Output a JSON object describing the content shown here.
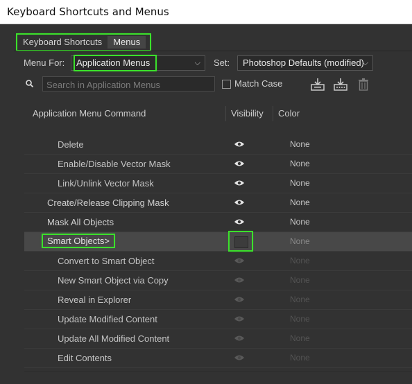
{
  "window": {
    "title": "Keyboard Shortcuts and Menus"
  },
  "tabs": [
    {
      "label": "Keyboard Shortcuts",
      "active": false
    },
    {
      "label": "Menus",
      "active": true
    }
  ],
  "menu_for": {
    "label": "Menu For:",
    "value": "Application Menus"
  },
  "set": {
    "label": "Set:",
    "value": "Photoshop Defaults (modified)"
  },
  "search": {
    "placeholder": "Search in Application Menus",
    "value": ""
  },
  "match_case": {
    "label": "Match Case",
    "checked": false
  },
  "toolbar": {
    "icons": [
      "save-set-icon",
      "save-set-as-icon",
      "delete-set-icon"
    ]
  },
  "columns": {
    "command": "Application Menu Command",
    "visibility": "Visibility",
    "color": "Color"
  },
  "rows": [
    {
      "label": "Delete",
      "indent": 2,
      "visible": true,
      "color": "None"
    },
    {
      "label": "Enable/Disable Vector Mask",
      "indent": 2,
      "visible": true,
      "color": "None"
    },
    {
      "label": "Link/Unlink Vector Mask",
      "indent": 2,
      "visible": true,
      "color": "None"
    },
    {
      "label": "Create/Release Clipping Mask",
      "indent": 1,
      "visible": true,
      "color": "None"
    },
    {
      "label": "Mask All Objects",
      "indent": 1,
      "visible": true,
      "color": "None"
    },
    {
      "label": "Smart Objects>",
      "indent": 1,
      "visible": false,
      "color": "None",
      "selected": true
    },
    {
      "label": "Convert to Smart Object",
      "indent": 2,
      "visible": true,
      "color": "None",
      "dim": true
    },
    {
      "label": "New Smart Object via Copy",
      "indent": 2,
      "visible": true,
      "color": "None",
      "dim": true
    },
    {
      "label": "Reveal in Explorer",
      "indent": 2,
      "visible": true,
      "color": "None",
      "dim": true
    },
    {
      "label": "Update Modified Content",
      "indent": 2,
      "visible": true,
      "color": "None",
      "dim": true
    },
    {
      "label": "Update All Modified Content",
      "indent": 2,
      "visible": true,
      "color": "None",
      "dim": true
    },
    {
      "label": "Edit Contents",
      "indent": 2,
      "visible": true,
      "color": "None",
      "dim": true
    }
  ],
  "colors": {
    "panel": "#323232",
    "highlight": "#3be12b"
  }
}
